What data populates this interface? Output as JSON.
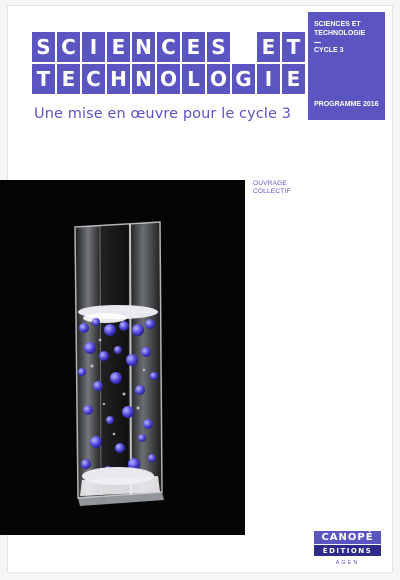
{
  "title": {
    "line1": [
      "S",
      "C",
      "I",
      "E",
      "N",
      "C",
      "E",
      "S",
      "",
      "E",
      "T"
    ],
    "line2": [
      "T",
      "E",
      "C",
      "H",
      "N",
      "O",
      "L",
      "O",
      "G",
      "I",
      "E"
    ]
  },
  "subtitle": "Une mise en œuvre pour le cycle 3",
  "banner": {
    "subject": "SCIENCES ET TECHNOLOGIE",
    "cycle": "CYCLE 3",
    "programme": "PROGRAMME 2016"
  },
  "ouvrage": {
    "line1": "OUVRAGE",
    "line2": "COLLECTIF"
  },
  "publisher": {
    "name": "CANOPÉ",
    "editions": "ÉDITIONS",
    "city": "AGEN"
  },
  "colors": {
    "accent": "#5b55c2",
    "dark_accent": "#2f2b8a",
    "photo_bg": "#050505"
  },
  "icons": [
    "glass-column-photo"
  ]
}
